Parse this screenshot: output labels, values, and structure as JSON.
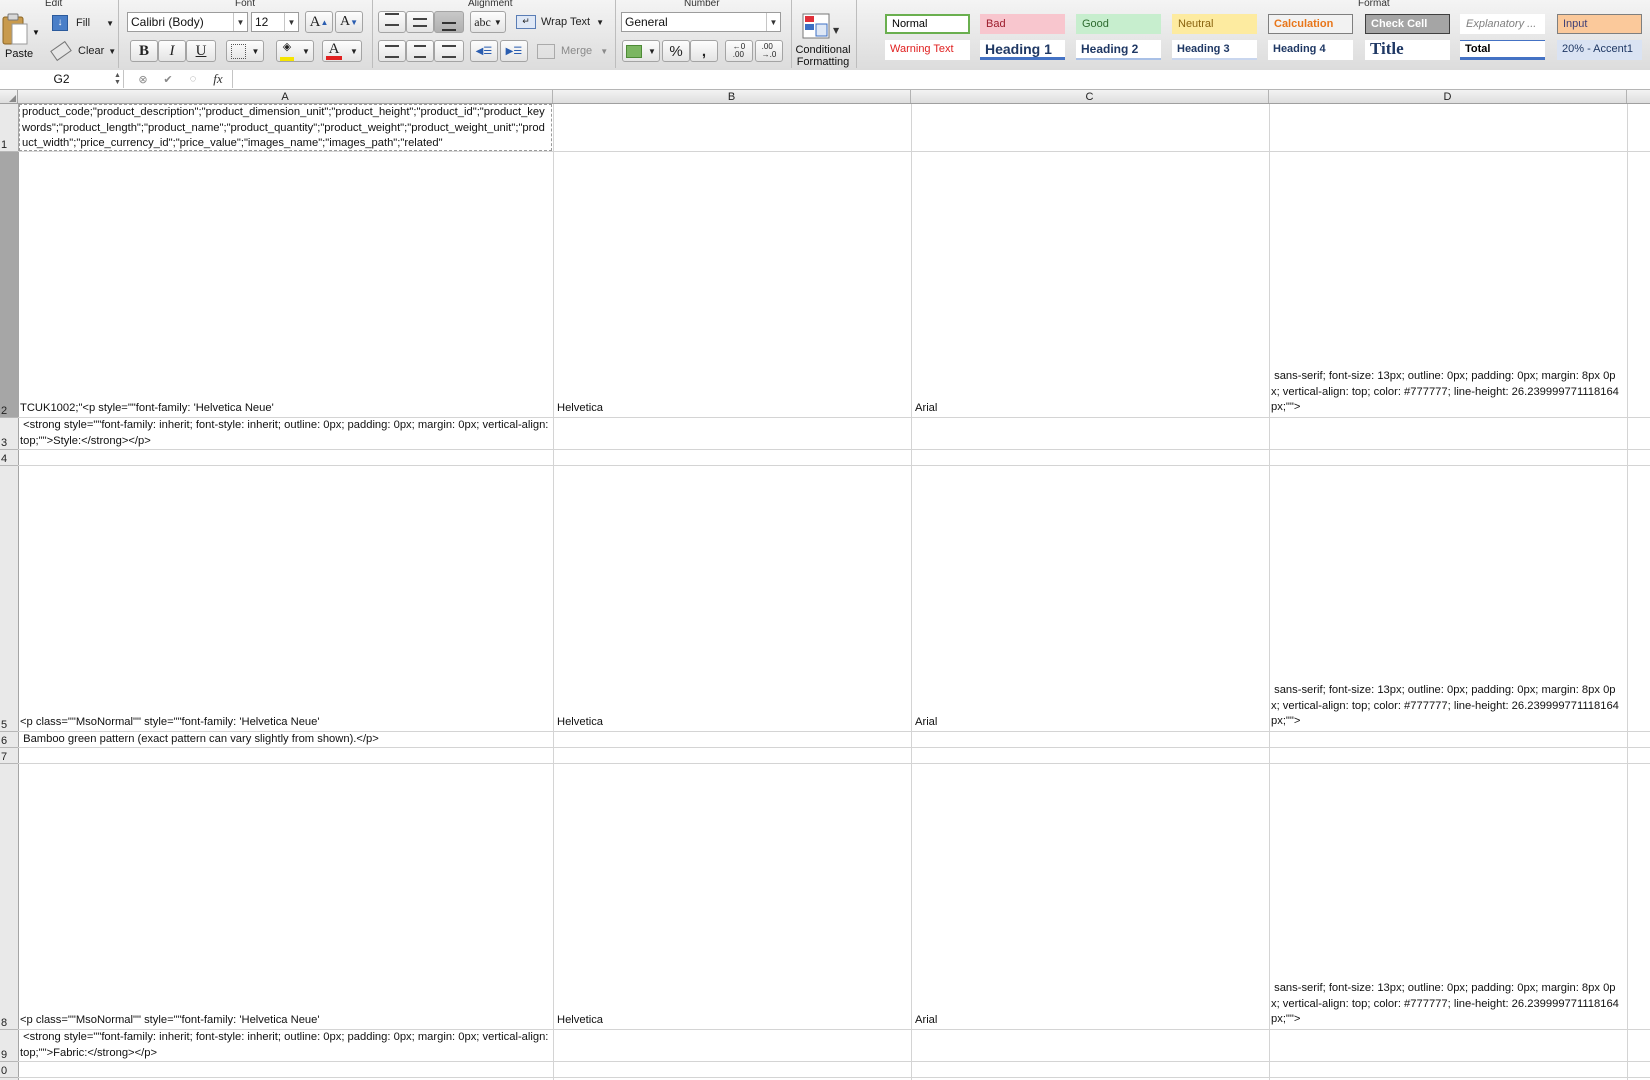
{
  "ribbon": {
    "groups": {
      "edit": "Edit",
      "font": "Font",
      "alignment": "Alignment",
      "number": "Number",
      "format": "Format"
    },
    "paste_label": "Paste",
    "fill_label": "Fill",
    "clear_label": "Clear",
    "font_name": "Calibri (Body)",
    "font_size": "12",
    "bold": "B",
    "italic": "I",
    "underline": "U",
    "wrap_text_label": "Wrap Text",
    "merge_label": "Merge",
    "number_format": "General",
    "percent": "%",
    "comma": ",",
    "conditional_formatting_label": "Conditional Formatting",
    "styles": [
      {
        "label": "Normal",
        "color": "#000000",
        "bg": "#ffffff",
        "border": "#6aaf4f"
      },
      {
        "label": "Bad",
        "color": "#9c1c2c",
        "bg": "#f8c6ce",
        "border": "#f8c6ce"
      },
      {
        "label": "Good",
        "color": "#2e6b30",
        "bg": "#c7eece",
        "border": "#c7eece"
      },
      {
        "label": "Neutral",
        "color": "#8a6410",
        "bg": "#fdeba0",
        "border": "#fdeba0"
      },
      {
        "label": "Calculation",
        "color": "#e8761a",
        "bg": "#f2f2f2",
        "border": "#7f7f7f"
      },
      {
        "label": "Check Cell",
        "color": "#ffffff",
        "bg": "#a5a5a5",
        "border": "#3f3f3f"
      },
      {
        "label": "Explanatory ...",
        "color": "#7f7f7f",
        "bg": "#ffffff",
        "border": "#ffffff"
      },
      {
        "label": "Input",
        "color": "#3f3f76",
        "bg": "#fbc99b",
        "border": "#7f7f7f"
      },
      {
        "label": "Warning Text",
        "color": "#e02020",
        "bg": "#ffffff",
        "border": "#ffffff"
      },
      {
        "label": "Heading 1",
        "color": "#1f3864",
        "bg": "#ffffff",
        "border": "#4472c4"
      },
      {
        "label": "Heading 2",
        "color": "#1f3864",
        "bg": "#ffffff",
        "border": "#a9c0e6"
      },
      {
        "label": "Heading 3",
        "color": "#1f3864",
        "bg": "#ffffff",
        "border": "#c9d6ee"
      },
      {
        "label": "Heading 4",
        "color": "#1f3864",
        "bg": "#ffffff",
        "border": "#ffffff"
      },
      {
        "label": "Title",
        "color": "#1f3864",
        "bg": "#ffffff",
        "border": "#ffffff"
      },
      {
        "label": "Total",
        "color": "#000000",
        "bg": "#ffffff",
        "border": "#4472c4"
      },
      {
        "label": "20% - Accent1",
        "color": "#1f3864",
        "bg": "#dae3f3",
        "border": "#dae3f3"
      }
    ]
  },
  "formula_bar": {
    "name_box": "G2",
    "fx": "fx",
    "content": ""
  },
  "columns": [
    "A",
    "B",
    "C",
    "D"
  ],
  "rows": [
    "1",
    "2",
    "3",
    "4",
    "5",
    "6",
    "7",
    "8",
    "9",
    "0"
  ],
  "cells": {
    "A1": "product_code;\"product_description\";\"product_dimension_unit\";\"product_height\";\"product_id\";\"product_keywords\";\"product_length\";\"product_name\";\"product_quantity\";\"product_weight\";\"product_weight_unit\";\"product_width\";\"price_currency_id\";\"price_value\";\"images_name\";\"images_path\";\"related\"",
    "A2": "TCUK1002;\"<p style=\"\"font-family: 'Helvetica Neue'",
    "B2": "Helvetica",
    "C2": "Arial",
    "D2": " sans-serif; font-size: 13px; outline: 0px; padding: 0px; margin: 8px 0px; vertical-align: top; color: #777777; line-height: 26.239999771118164px;\"\">",
    "A3": " <strong style=\"\"font-family: inherit; font-style: inherit; outline: 0px; padding: 0px; margin: 0px; vertical-align: top;\"\">Style:</strong></p>",
    "A5": "<p class=\"\"MsoNormal\"\" style=\"\"font-family: 'Helvetica Neue'",
    "B5": "Helvetica",
    "C5": "Arial",
    "D5": " sans-serif; font-size: 13px; outline: 0px; padding: 0px; margin: 8px 0px; vertical-align: top; color: #777777; line-height: 26.239999771118164px;\"\">",
    "A6": " Bamboo green pattern (exact pattern can vary slightly from shown).</p>",
    "A8": "<p class=\"\"MsoNormal\"\" style=\"\"font-family: 'Helvetica Neue'",
    "B8": "Helvetica",
    "C8": "Arial",
    "D8": " sans-serif; font-size: 13px; outline: 0px; padding: 0px; margin: 8px 0px; vertical-align: top; color: #777777; line-height: 26.239999771118164px;\"\">",
    "A9": " <strong style=\"\"font-family: inherit; font-style: inherit; outline: 0px; padding: 0px; margin: 0px; vertical-align: top;\"\">Fabric:</strong></p>"
  }
}
